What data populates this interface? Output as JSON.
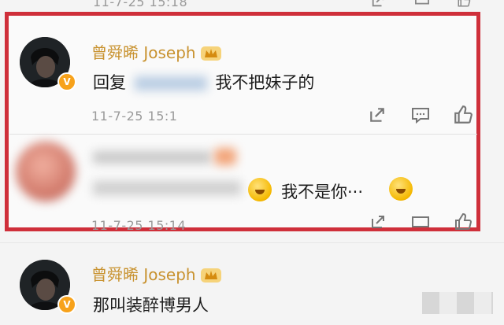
{
  "top_timestamp": "11-7-25 15:18",
  "comments": [
    {
      "author": "曾舜晞 Joseph",
      "reply_prefix": "回复",
      "text": "我不把妹子的",
      "timestamp": "11-7-25 15:1",
      "verified": "V"
    },
    {
      "author": "",
      "text": "我不是你···",
      "timestamp": "11-7-25 15:14"
    },
    {
      "author": "曾舜晞 Joseph",
      "text": "那叫装醉博男人",
      "verified": "V"
    }
  ],
  "colors": {
    "highlight": "#cf2f3a",
    "author": "#c8922f",
    "timestamp": "#9a9a9a"
  },
  "icons": [
    "share-icon",
    "comment-icon",
    "like-icon",
    "crown-icon",
    "verified-badge"
  ]
}
